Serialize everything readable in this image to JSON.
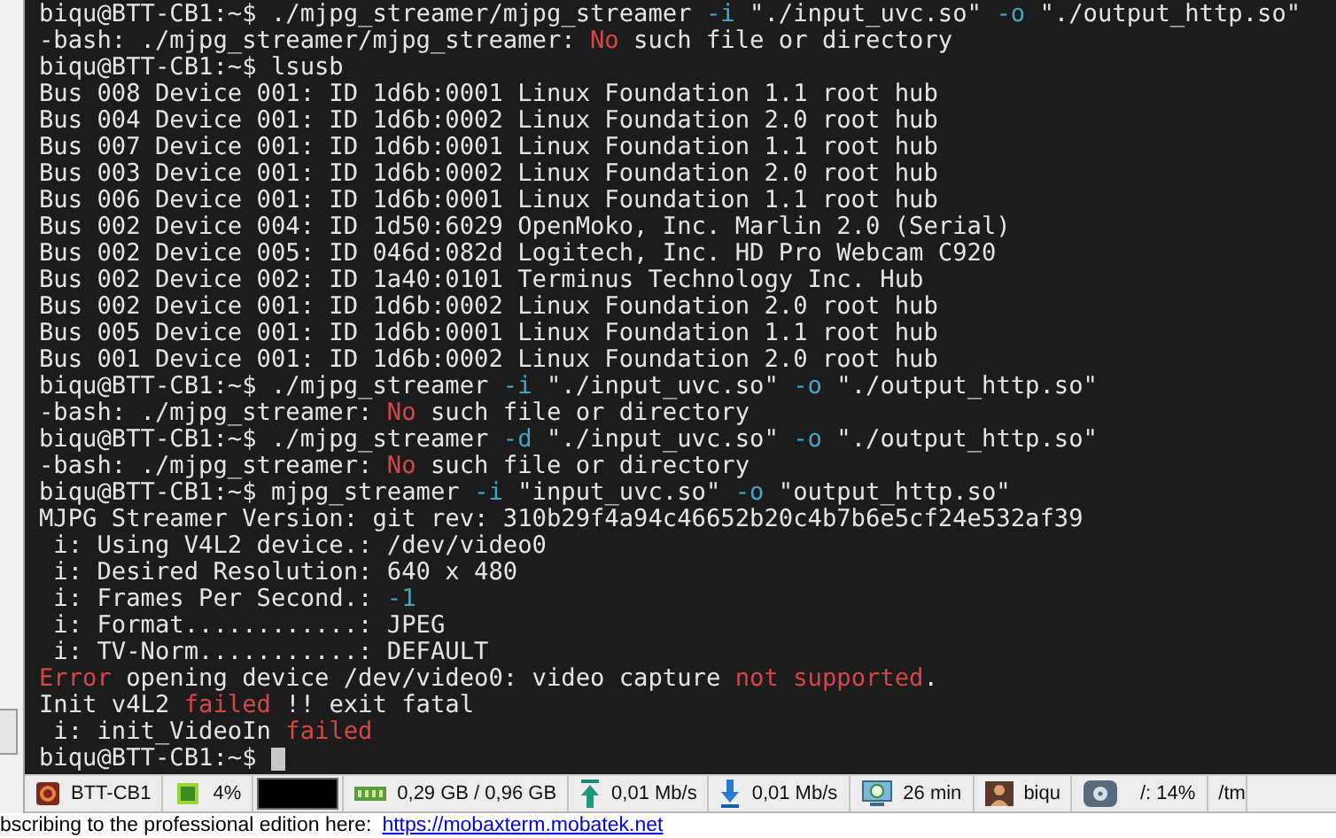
{
  "terminal": {
    "lines": [
      {
        "segments": [
          {
            "text": "biqu@BTT-CB1:~$ ./mjpg_streamer/mjpg_streamer ",
            "kind": "plain"
          },
          {
            "text": "-i",
            "kind": "option"
          },
          {
            "text": " \"./input_uvc.so\" ",
            "kind": "plain"
          },
          {
            "text": "-o",
            "kind": "option"
          },
          {
            "text": " \"./output_http.so\"",
            "kind": "plain"
          }
        ]
      },
      {
        "segments": [
          {
            "text": "-bash: ./mjpg_streamer/mjpg_streamer: ",
            "kind": "plain"
          },
          {
            "text": "No",
            "kind": "error"
          },
          {
            "text": " such file or directory",
            "kind": "plain"
          }
        ]
      },
      {
        "segments": [
          {
            "text": "biqu@BTT-CB1:~$ lsusb",
            "kind": "plain"
          }
        ]
      },
      {
        "segments": [
          {
            "text": "Bus 008 Device 001: ID 1d6b:0001 Linux Foundation 1.1 root hub",
            "kind": "plain"
          }
        ]
      },
      {
        "segments": [
          {
            "text": "Bus 004 Device 001: ID 1d6b:0002 Linux Foundation 2.0 root hub",
            "kind": "plain"
          }
        ]
      },
      {
        "segments": [
          {
            "text": "Bus 007 Device 001: ID 1d6b:0001 Linux Foundation 1.1 root hub",
            "kind": "plain"
          }
        ]
      },
      {
        "segments": [
          {
            "text": "Bus 003 Device 001: ID 1d6b:0002 Linux Foundation 2.0 root hub",
            "kind": "plain"
          }
        ]
      },
      {
        "segments": [
          {
            "text": "Bus 006 Device 001: ID 1d6b:0001 Linux Foundation 1.1 root hub",
            "kind": "plain"
          }
        ]
      },
      {
        "segments": [
          {
            "text": "Bus 002 Device 004: ID 1d50:6029 OpenMoko, Inc. Marlin 2.0 (Serial)",
            "kind": "plain"
          }
        ]
      },
      {
        "segments": [
          {
            "text": "Bus 002 Device 005: ID 046d:082d Logitech, Inc. HD Pro Webcam C920",
            "kind": "plain"
          }
        ]
      },
      {
        "segments": [
          {
            "text": "Bus 002 Device 002: ID 1a40:0101 Terminus Technology Inc. Hub",
            "kind": "plain"
          }
        ]
      },
      {
        "segments": [
          {
            "text": "Bus 002 Device 001: ID 1d6b:0002 Linux Foundation 2.0 root hub",
            "kind": "plain"
          }
        ]
      },
      {
        "segments": [
          {
            "text": "Bus 005 Device 001: ID 1d6b:0001 Linux Foundation 1.1 root hub",
            "kind": "plain"
          }
        ]
      },
      {
        "segments": [
          {
            "text": "Bus 001 Device 001: ID 1d6b:0002 Linux Foundation 2.0 root hub",
            "kind": "plain"
          }
        ]
      },
      {
        "segments": [
          {
            "text": "biqu@BTT-CB1:~$ ./mjpg_streamer ",
            "kind": "plain"
          },
          {
            "text": "-i",
            "kind": "option"
          },
          {
            "text": " \"./input_uvc.so\" ",
            "kind": "plain"
          },
          {
            "text": "-o",
            "kind": "option"
          },
          {
            "text": " \"./output_http.so\"",
            "kind": "plain"
          }
        ]
      },
      {
        "segments": [
          {
            "text": "-bash: ./mjpg_streamer: ",
            "kind": "plain"
          },
          {
            "text": "No",
            "kind": "error"
          },
          {
            "text": " such file or directory",
            "kind": "plain"
          }
        ]
      },
      {
        "segments": [
          {
            "text": "biqu@BTT-CB1:~$ ./mjpg_streamer ",
            "kind": "plain"
          },
          {
            "text": "-d",
            "kind": "option"
          },
          {
            "text": " \"./input_uvc.so\" ",
            "kind": "plain"
          },
          {
            "text": "-o",
            "kind": "option"
          },
          {
            "text": " \"./output_http.so\"",
            "kind": "plain"
          }
        ]
      },
      {
        "segments": [
          {
            "text": "-bash: ./mjpg_streamer: ",
            "kind": "plain"
          },
          {
            "text": "No",
            "kind": "error"
          },
          {
            "text": " such file or directory",
            "kind": "plain"
          }
        ]
      },
      {
        "segments": [
          {
            "text": "biqu@BTT-CB1:~$ mjpg_streamer ",
            "kind": "plain"
          },
          {
            "text": "-i",
            "kind": "option"
          },
          {
            "text": " \"input_uvc.so\" ",
            "kind": "plain"
          },
          {
            "text": "-o",
            "kind": "option"
          },
          {
            "text": " \"output_http.so\"",
            "kind": "plain"
          }
        ]
      },
      {
        "segments": [
          {
            "text": "MJPG Streamer Version: git rev: 310b29f4a94c46652b20c4b7b6e5cf24e532af39",
            "kind": "plain"
          }
        ]
      },
      {
        "segments": [
          {
            "text": " i: Using V4L2 device.: /dev/video0",
            "kind": "plain"
          }
        ]
      },
      {
        "segments": [
          {
            "text": " i: Desired Resolution: 640 x 480",
            "kind": "plain"
          }
        ]
      },
      {
        "segments": [
          {
            "text": " i: Frames Per Second.: ",
            "kind": "plain"
          },
          {
            "text": "-1",
            "kind": "option"
          }
        ]
      },
      {
        "segments": [
          {
            "text": " i: Format............: JPEG",
            "kind": "plain"
          }
        ]
      },
      {
        "segments": [
          {
            "text": " i: TV-Norm...........: DEFAULT",
            "kind": "plain"
          }
        ]
      },
      {
        "segments": [
          {
            "text": "Error",
            "kind": "error"
          },
          {
            "text": " opening device /dev/video0: video capture ",
            "kind": "plain"
          },
          {
            "text": "not supported",
            "kind": "error"
          },
          {
            "text": ".",
            "kind": "plain"
          }
        ]
      },
      {
        "segments": [
          {
            "text": "Init v4L2 ",
            "kind": "plain"
          },
          {
            "text": "failed",
            "kind": "error"
          },
          {
            "text": " !! exit fatal",
            "kind": "plain"
          }
        ]
      },
      {
        "segments": [
          {
            "text": " i: init_VideoIn ",
            "kind": "plain"
          },
          {
            "text": "failed",
            "kind": "error"
          }
        ]
      },
      {
        "segments": [
          {
            "text": "biqu@BTT-CB1:~$ ",
            "kind": "plain"
          }
        ]
      }
    ]
  },
  "status_bar": {
    "items": [
      {
        "kind": "host",
        "text": "BTT-CB1"
      },
      {
        "kind": "cpu",
        "text": "4%"
      },
      {
        "kind": "graph"
      },
      {
        "kind": "memory",
        "text": "0,29 GB / 0,96 GB"
      },
      {
        "kind": "upload",
        "text": "0,01 Mb/s"
      },
      {
        "kind": "download",
        "text": "0,01 Mb/s"
      },
      {
        "kind": "uptime",
        "text": "26 min"
      },
      {
        "kind": "user",
        "text": "biqu"
      },
      {
        "kind": "disk",
        "text": "/: 14%"
      },
      {
        "kind": "path",
        "text": "/tm"
      }
    ]
  },
  "promo": {
    "text": "bscribing to the professional edition here:",
    "link": "https://mobaxterm.mobatek.net"
  }
}
